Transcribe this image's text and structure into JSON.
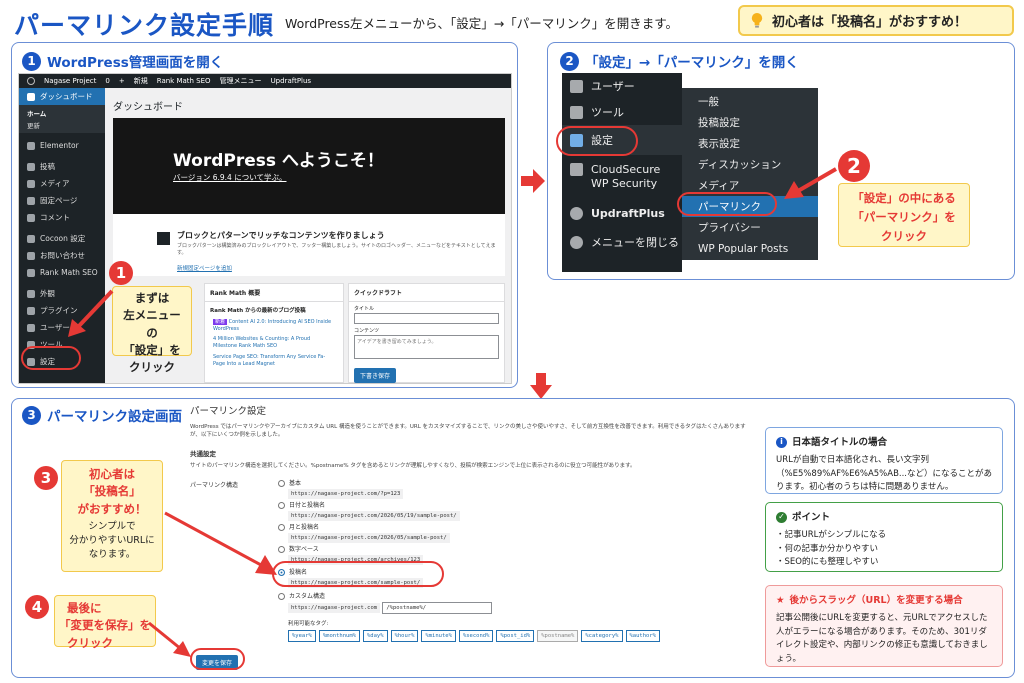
{
  "header": {
    "title": "パーマリンク設定手順",
    "subtitle": "WordPress左メニューから、「設定」→「パーマリンク」を開きます。",
    "tip": "初心者は「投稿名」がおすすめ！"
  },
  "step1": {
    "num": "1",
    "title": "WordPress管理画面を開く",
    "admin_bar": [
      "Nagase Project",
      "0",
      "+",
      "新規",
      "Rank Math SEO",
      "管理メニュー",
      "UpdraftPlus"
    ],
    "sidebar": [
      "ダッシュボード",
      "Elementor",
      "投稿",
      "メディア",
      "固定ページ",
      "コメント",
      "Cocoon 設定",
      "お問い合わせ",
      "Rank Math SEO",
      "外観",
      "プラグイン",
      "ユーザー",
      "ツール",
      "設定"
    ],
    "sidebar_sub": [
      "ホーム",
      "更新"
    ],
    "page_heading": "ダッシュボード",
    "welcome_title": "WordPress へようこそ！",
    "welcome_link": "バージョン 6.9.4 について学ぶ。",
    "block_title": "ブロックとパターンでリッチなコンテンツを作りましょう",
    "block_desc": "ブロックパターンは構築済みのブロックレイアウトで、フッター構築しましょう。サイトのロゴヘッダー、メニューなどをテキストとしてえます。",
    "block_link": "新規固定ページを追加",
    "rank_title": "Rank Math 概要",
    "rank_sub": "Rank Math からの最新のブログ投稿",
    "rank_new": "新着",
    "rank_posts": [
      "Content AI 2.0: Introducing AI SEO Inside WordPress",
      "4 Million Websites & Counting: A Proud Milestone Rank Math SEO",
      "Service Page SEO: Transform Any Service Fa- Page Into a Lead Magnet"
    ],
    "draft_title": "クイックドラフト",
    "draft_title_label": "タイトル",
    "draft_content_label": "コンテンツ",
    "draft_placeholder": "アイデアを書き留めてみましょう。",
    "draft_button": "下書き保存",
    "marker": "1",
    "callout": [
      "まずは",
      "左メニューの",
      "「設定」を",
      "クリック"
    ]
  },
  "step2": {
    "num": "2",
    "title": "「設定」→「パーマリンク」を開く",
    "menu": [
      "ユーザー",
      "ツール",
      "設定",
      "CloudSecure WP Security",
      "UpdraftPlus",
      "メニューを閉じる"
    ],
    "submenu": [
      "一般",
      "投稿設定",
      "表示設定",
      "ディスカッション",
      "メディア",
      "パーマリンク",
      "プライバシー",
      "WP Popular Posts"
    ],
    "marker": "2",
    "callout": [
      "「設定」の中にある",
      "「パーマリンク」を",
      "クリック"
    ]
  },
  "step3": {
    "num": "3",
    "title": "パーマリンク設定画面",
    "heading": "パーマリンク設定",
    "intro": "WordPress ではパーマリンクやアーカイブにカスタム URL 構造を使うことができます。URL をカスタマイズすることで、リンクの美しさや使いやすさ、そして前方互換性を改善できます。利用できるタグはたくさんありますが、以下にいくつか例を示しました。",
    "common_heading": "共通設定",
    "common_desc": "サイトのパーマリンク構造を選択してください。%postname% タグを含めるとリンクが理解しやすくなり、投稿が検索エンジンで上位に表示されるのに役立つ可能性があります。",
    "structure_label": "パーマリンク構造",
    "options": [
      {
        "label": "基本",
        "url": "https://nagase-project.com/?p=123"
      },
      {
        "label": "日付と投稿名",
        "url": "https://nagase-project.com/2026/05/19/sample-post/"
      },
      {
        "label": "月と投稿名",
        "url": "https://nagase-project.com/2026/05/sample-post/"
      },
      {
        "label": "数字ベース",
        "url": "https://nagase-project.com/archives/123"
      },
      {
        "label": "投稿名",
        "url": "https://nagase-project.com/sample-post/"
      },
      {
        "label": "カスタム構造",
        "url": "https://nagase-project.com"
      }
    ],
    "custom_value": "/%postname%/",
    "tags_label": "利用可能なタグ:",
    "tags": [
      "%year%",
      "%monthnum%",
      "%day%",
      "%hour%",
      "%minute%",
      "%second%",
      "%post_id%",
      "%postname%",
      "%category%",
      "%author%"
    ],
    "save_button": "変更を保存",
    "marker3": "3",
    "callout3": [
      "初心者は",
      "「投稿名」",
      "がおすすめ！"
    ],
    "callout3_sub": [
      "シンプルで",
      "分かりやすいURLに",
      "なります。"
    ],
    "marker4": "4",
    "callout4": [
      "最後に",
      "「変更を保存」を",
      "クリック"
    ]
  },
  "info": {
    "jp_title": "日本語タイトルの場合",
    "jp_body": "URLが自動で日本語化され、長い文字列（%E5%89%AF%E6%A5%AB...など）になることがあります。初心者のうちは特に問題ありません。",
    "point_title": "ポイント",
    "point_items": [
      "・記事URLがシンプルになる",
      "・何の記事か分かりやすい",
      "・SEO的にも整理しやすい"
    ],
    "slug_title": "後からスラッグ（URL）を変更する場合",
    "slug_body": "記事公開後にURLを変更すると、元URLでアクセスした人がエラーになる場合があります。そのため、301リダイレクト設定や、内部リンクの修正も意識しておきましょう。"
  },
  "colors": {
    "accent": "#1a56c4",
    "red": "#e53935",
    "yellow": "#fff6c8",
    "wp_dark": "#1d2327",
    "wp_blue": "#2271b1"
  }
}
